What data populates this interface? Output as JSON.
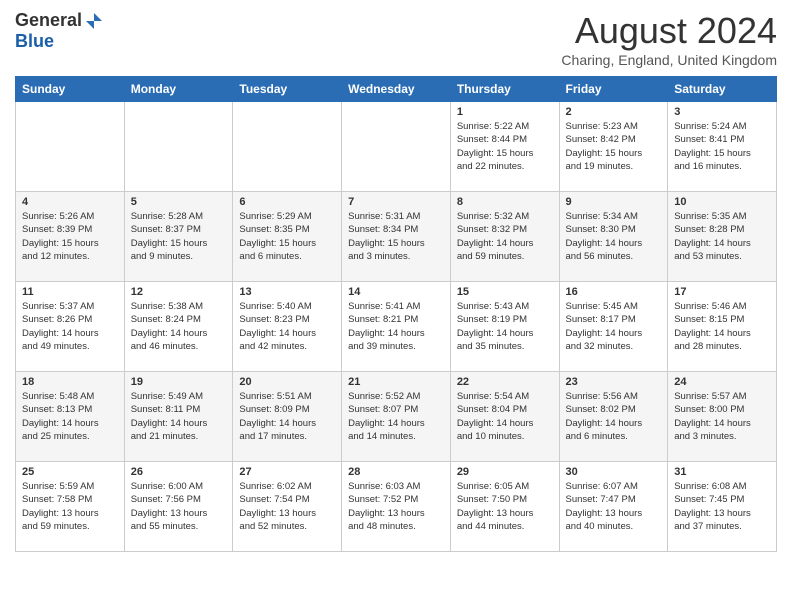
{
  "header": {
    "logo_general": "General",
    "logo_blue": "Blue",
    "month_title": "August 2024",
    "location": "Charing, England, United Kingdom"
  },
  "days_of_week": [
    "Sunday",
    "Monday",
    "Tuesday",
    "Wednesday",
    "Thursday",
    "Friday",
    "Saturday"
  ],
  "weeks": [
    [
      {
        "day": "",
        "info": ""
      },
      {
        "day": "",
        "info": ""
      },
      {
        "day": "",
        "info": ""
      },
      {
        "day": "",
        "info": ""
      },
      {
        "day": "1",
        "info": "Sunrise: 5:22 AM\nSunset: 8:44 PM\nDaylight: 15 hours\nand 22 minutes."
      },
      {
        "day": "2",
        "info": "Sunrise: 5:23 AM\nSunset: 8:42 PM\nDaylight: 15 hours\nand 19 minutes."
      },
      {
        "day": "3",
        "info": "Sunrise: 5:24 AM\nSunset: 8:41 PM\nDaylight: 15 hours\nand 16 minutes."
      }
    ],
    [
      {
        "day": "4",
        "info": "Sunrise: 5:26 AM\nSunset: 8:39 PM\nDaylight: 15 hours\nand 12 minutes."
      },
      {
        "day": "5",
        "info": "Sunrise: 5:28 AM\nSunset: 8:37 PM\nDaylight: 15 hours\nand 9 minutes."
      },
      {
        "day": "6",
        "info": "Sunrise: 5:29 AM\nSunset: 8:35 PM\nDaylight: 15 hours\nand 6 minutes."
      },
      {
        "day": "7",
        "info": "Sunrise: 5:31 AM\nSunset: 8:34 PM\nDaylight: 15 hours\nand 3 minutes."
      },
      {
        "day": "8",
        "info": "Sunrise: 5:32 AM\nSunset: 8:32 PM\nDaylight: 14 hours\nand 59 minutes."
      },
      {
        "day": "9",
        "info": "Sunrise: 5:34 AM\nSunset: 8:30 PM\nDaylight: 14 hours\nand 56 minutes."
      },
      {
        "day": "10",
        "info": "Sunrise: 5:35 AM\nSunset: 8:28 PM\nDaylight: 14 hours\nand 53 minutes."
      }
    ],
    [
      {
        "day": "11",
        "info": "Sunrise: 5:37 AM\nSunset: 8:26 PM\nDaylight: 14 hours\nand 49 minutes."
      },
      {
        "day": "12",
        "info": "Sunrise: 5:38 AM\nSunset: 8:24 PM\nDaylight: 14 hours\nand 46 minutes."
      },
      {
        "day": "13",
        "info": "Sunrise: 5:40 AM\nSunset: 8:23 PM\nDaylight: 14 hours\nand 42 minutes."
      },
      {
        "day": "14",
        "info": "Sunrise: 5:41 AM\nSunset: 8:21 PM\nDaylight: 14 hours\nand 39 minutes."
      },
      {
        "day": "15",
        "info": "Sunrise: 5:43 AM\nSunset: 8:19 PM\nDaylight: 14 hours\nand 35 minutes."
      },
      {
        "day": "16",
        "info": "Sunrise: 5:45 AM\nSunset: 8:17 PM\nDaylight: 14 hours\nand 32 minutes."
      },
      {
        "day": "17",
        "info": "Sunrise: 5:46 AM\nSunset: 8:15 PM\nDaylight: 14 hours\nand 28 minutes."
      }
    ],
    [
      {
        "day": "18",
        "info": "Sunrise: 5:48 AM\nSunset: 8:13 PM\nDaylight: 14 hours\nand 25 minutes."
      },
      {
        "day": "19",
        "info": "Sunrise: 5:49 AM\nSunset: 8:11 PM\nDaylight: 14 hours\nand 21 minutes."
      },
      {
        "day": "20",
        "info": "Sunrise: 5:51 AM\nSunset: 8:09 PM\nDaylight: 14 hours\nand 17 minutes."
      },
      {
        "day": "21",
        "info": "Sunrise: 5:52 AM\nSunset: 8:07 PM\nDaylight: 14 hours\nand 14 minutes."
      },
      {
        "day": "22",
        "info": "Sunrise: 5:54 AM\nSunset: 8:04 PM\nDaylight: 14 hours\nand 10 minutes."
      },
      {
        "day": "23",
        "info": "Sunrise: 5:56 AM\nSunset: 8:02 PM\nDaylight: 14 hours\nand 6 minutes."
      },
      {
        "day": "24",
        "info": "Sunrise: 5:57 AM\nSunset: 8:00 PM\nDaylight: 14 hours\nand 3 minutes."
      }
    ],
    [
      {
        "day": "25",
        "info": "Sunrise: 5:59 AM\nSunset: 7:58 PM\nDaylight: 13 hours\nand 59 minutes."
      },
      {
        "day": "26",
        "info": "Sunrise: 6:00 AM\nSunset: 7:56 PM\nDaylight: 13 hours\nand 55 minutes."
      },
      {
        "day": "27",
        "info": "Sunrise: 6:02 AM\nSunset: 7:54 PM\nDaylight: 13 hours\nand 52 minutes."
      },
      {
        "day": "28",
        "info": "Sunrise: 6:03 AM\nSunset: 7:52 PM\nDaylight: 13 hours\nand 48 minutes."
      },
      {
        "day": "29",
        "info": "Sunrise: 6:05 AM\nSunset: 7:50 PM\nDaylight: 13 hours\nand 44 minutes."
      },
      {
        "day": "30",
        "info": "Sunrise: 6:07 AM\nSunset: 7:47 PM\nDaylight: 13 hours\nand 40 minutes."
      },
      {
        "day": "31",
        "info": "Sunrise: 6:08 AM\nSunset: 7:45 PM\nDaylight: 13 hours\nand 37 minutes."
      }
    ]
  ]
}
